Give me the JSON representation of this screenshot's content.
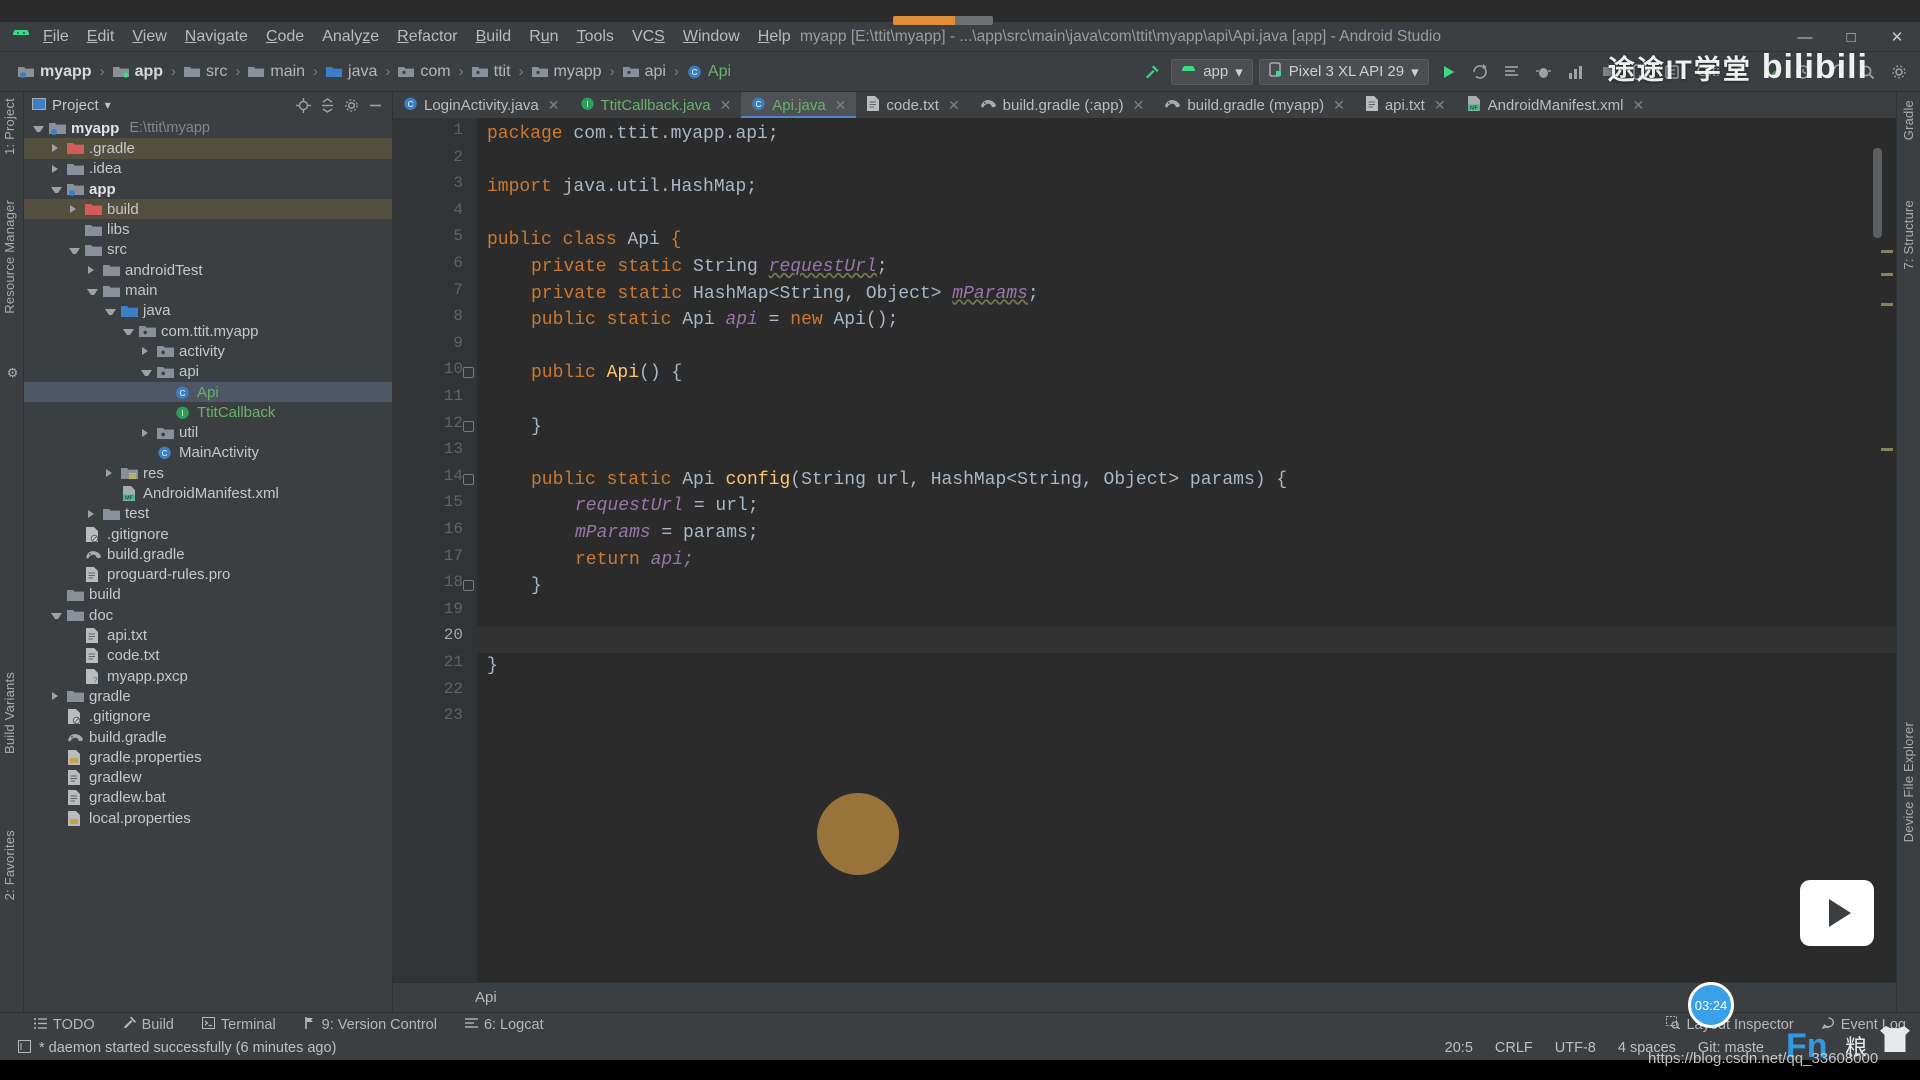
{
  "window": {
    "title": "myapp [E:\\ttit\\myapp] - ...\\app\\src\\main\\java\\com\\ttit\\myapp\\api\\Api.java [app] - Android Studio",
    "minimize": "—",
    "maximize": "□",
    "close": "✕"
  },
  "menu": {
    "items": [
      "File",
      "Edit",
      "View",
      "Navigate",
      "Code",
      "Analyze",
      "Refactor",
      "Build",
      "Run",
      "Tools",
      "VCS",
      "Window",
      "Help"
    ]
  },
  "breadcrumb": {
    "items": [
      {
        "label": "myapp",
        "icon": "module-folder-icon",
        "bold": true
      },
      {
        "label": "app",
        "icon": "module-folder-icon",
        "bold": true
      },
      {
        "label": "src",
        "icon": "folder-icon",
        "bold": false
      },
      {
        "label": "main",
        "icon": "folder-icon",
        "bold": false
      },
      {
        "label": "java",
        "icon": "source-folder-icon",
        "bold": false
      },
      {
        "label": "com",
        "icon": "package-icon",
        "bold": false
      },
      {
        "label": "ttit",
        "icon": "package-icon",
        "bold": false
      },
      {
        "label": "myapp",
        "icon": "package-icon",
        "bold": false
      },
      {
        "label": "api",
        "icon": "package-icon",
        "bold": false
      },
      {
        "label": "Api",
        "icon": "class-icon",
        "bold": false,
        "isClass": true
      }
    ],
    "separator": "›"
  },
  "toolbar": {
    "run_config": "app",
    "device": "Pixel 3 XL API 29",
    "git_label": "Git:",
    "run_icon": "run-icon",
    "rerun_icon": "rerun-icon",
    "apply_changes_icon": "apply-changes-icon",
    "debug_icon": "debug-icon",
    "profile_icon": "profile-icon",
    "avd_icon": "avd-manager-icon",
    "sdk_icon": "sdk-manager-icon",
    "search_icon": "search-icon",
    "commit_icon": "commit-icon",
    "update_icon": "update-project-icon",
    "hammer_icon": "build-hammer-icon"
  },
  "left_strips": [
    {
      "label": "1: Project",
      "name": "tool-window-project"
    },
    {
      "label": "Resource Manager",
      "name": "tool-window-resource-manager"
    },
    {
      "label": "Build Variants",
      "name": "tool-window-build-variants"
    },
    {
      "label": "2: Favorites",
      "name": "tool-window-favorites"
    }
  ],
  "right_strips": [
    {
      "label": "Gradle",
      "name": "tool-window-gradle"
    },
    {
      "label": "7: Structure",
      "name": "tool-window-structure"
    },
    {
      "label": "Device File Explorer",
      "name": "tool-window-device-file-explorer"
    }
  ],
  "project_panel": {
    "title": "Project",
    "dropdown": "▾",
    "tree": [
      {
        "indent": 0,
        "arrow": "down",
        "icon": "module-folder-icon",
        "label": "myapp",
        "bold": true,
        "hint": "E:\\ttit\\myapp"
      },
      {
        "indent": 1,
        "arrow": "right",
        "icon": "excluded-folder-icon",
        "label": ".gradle",
        "highlight": "build"
      },
      {
        "indent": 1,
        "arrow": "right",
        "icon": "folder-icon",
        "label": ".idea"
      },
      {
        "indent": 1,
        "arrow": "down",
        "icon": "module-folder-icon",
        "label": "app",
        "bold": true
      },
      {
        "indent": 2,
        "arrow": "right",
        "icon": "excluded-folder-icon",
        "label": "build",
        "highlight": "build"
      },
      {
        "indent": 2,
        "arrow": "none",
        "icon": "folder-icon",
        "label": "libs"
      },
      {
        "indent": 2,
        "arrow": "down",
        "icon": "folder-icon",
        "label": "src"
      },
      {
        "indent": 3,
        "arrow": "right",
        "icon": "folder-icon",
        "label": "androidTest"
      },
      {
        "indent": 3,
        "arrow": "down",
        "icon": "folder-icon",
        "label": "main"
      },
      {
        "indent": 4,
        "arrow": "down",
        "icon": "source-folder-icon",
        "label": "java"
      },
      {
        "indent": 5,
        "arrow": "down",
        "icon": "package-icon",
        "label": "com.ttit.myapp"
      },
      {
        "indent": 6,
        "arrow": "right",
        "icon": "package-icon",
        "label": "activity"
      },
      {
        "indent": 6,
        "arrow": "down",
        "icon": "package-icon",
        "label": "api"
      },
      {
        "indent": 7,
        "arrow": "none",
        "icon": "java-class-icon",
        "label": "Api",
        "green": true,
        "selected": true
      },
      {
        "indent": 7,
        "arrow": "none",
        "icon": "java-interface-icon",
        "label": "TtitCallback",
        "green": true
      },
      {
        "indent": 6,
        "arrow": "right",
        "icon": "package-icon",
        "label": "util"
      },
      {
        "indent": 6,
        "arrow": "none",
        "icon": "java-class-icon",
        "label": "MainActivity"
      },
      {
        "indent": 4,
        "arrow": "right",
        "icon": "res-folder-icon",
        "label": "res"
      },
      {
        "indent": 4,
        "arrow": "none",
        "icon": "manifest-icon",
        "label": "AndroidManifest.xml"
      },
      {
        "indent": 3,
        "arrow": "right",
        "icon": "folder-icon",
        "label": "test"
      },
      {
        "indent": 2,
        "arrow": "none",
        "icon": "gitignore-icon",
        "label": ".gitignore"
      },
      {
        "indent": 2,
        "arrow": "none",
        "icon": "gradle-icon",
        "label": "build.gradle"
      },
      {
        "indent": 2,
        "arrow": "none",
        "icon": "file-icon",
        "label": "proguard-rules.pro"
      },
      {
        "indent": 1,
        "arrow": "none",
        "icon": "folder-icon",
        "label": "build"
      },
      {
        "indent": 1,
        "arrow": "down",
        "icon": "folder-icon",
        "label": "doc"
      },
      {
        "indent": 2,
        "arrow": "none",
        "icon": "file-icon",
        "label": "api.txt"
      },
      {
        "indent": 2,
        "arrow": "none",
        "icon": "file-icon",
        "label": "code.txt"
      },
      {
        "indent": 2,
        "arrow": "none",
        "icon": "unknown-file-icon",
        "label": "myapp.pxcp"
      },
      {
        "indent": 1,
        "arrow": "right",
        "icon": "folder-icon",
        "label": "gradle"
      },
      {
        "indent": 1,
        "arrow": "none",
        "icon": "gitignore-icon",
        "label": ".gitignore"
      },
      {
        "indent": 1,
        "arrow": "none",
        "icon": "gradle-icon",
        "label": "build.gradle"
      },
      {
        "indent": 1,
        "arrow": "none",
        "icon": "properties-icon",
        "label": "gradle.properties"
      },
      {
        "indent": 1,
        "arrow": "none",
        "icon": "file-icon",
        "label": "gradlew"
      },
      {
        "indent": 1,
        "arrow": "none",
        "icon": "file-icon",
        "label": "gradlew.bat"
      },
      {
        "indent": 1,
        "arrow": "none",
        "icon": "properties-icon",
        "label": "local.properties"
      }
    ]
  },
  "editor": {
    "tabs": [
      {
        "label": "LoginActivity.java",
        "icon": "java-class-icon",
        "active": false,
        "close": "✕"
      },
      {
        "label": "TtitCallback.java",
        "icon": "java-interface-icon",
        "active": false,
        "close": "✕"
      },
      {
        "label": "Api.java",
        "icon": "java-class-icon",
        "active": true,
        "close": "✕"
      },
      {
        "label": "code.txt",
        "icon": "file-icon",
        "active": false,
        "close": "✕"
      },
      {
        "label": "build.gradle (:app)",
        "icon": "gradle-icon",
        "active": false,
        "close": "✕"
      },
      {
        "label": "build.gradle (myapp)",
        "icon": "gradle-icon",
        "active": false,
        "close": "✕"
      },
      {
        "label": "api.txt",
        "icon": "file-icon",
        "active": false,
        "close": "✕"
      },
      {
        "label": "AndroidManifest.xml",
        "icon": "manifest-icon",
        "active": false,
        "close": "✕"
      }
    ],
    "line_numbers": [
      "1",
      "2",
      "3",
      "4",
      "5",
      "6",
      "7",
      "8",
      "9",
      "10",
      "11",
      "12",
      "13",
      "14",
      "15",
      "16",
      "17",
      "18",
      "19",
      "20",
      "21",
      "22",
      "23"
    ],
    "current_line": 20,
    "breadcrumb_bottom": "Api",
    "code_lines": [
      {
        "n": 1,
        "indent": 0,
        "tokens": [
          {
            "t": "package ",
            "c": "k"
          },
          {
            "t": "com.ttit.myapp.api;",
            "c": "p"
          }
        ]
      },
      {
        "n": 2,
        "indent": 0,
        "tokens": []
      },
      {
        "n": 3,
        "indent": 0,
        "tokens": [
          {
            "t": "import ",
            "c": "k"
          },
          {
            "t": "java.util.HashMap;",
            "c": "p"
          }
        ]
      },
      {
        "n": 4,
        "indent": 0,
        "tokens": []
      },
      {
        "n": 5,
        "indent": 0,
        "tokens": [
          {
            "t": "public class ",
            "c": "k"
          },
          {
            "t": "Api ",
            "c": "p"
          },
          {
            "t": "{",
            "c": "k"
          }
        ]
      },
      {
        "n": 6,
        "indent": 1,
        "tokens": [
          {
            "t": "private static ",
            "c": "k"
          },
          {
            "t": "String ",
            "c": "p"
          },
          {
            "t": "requestUrl",
            "c": "f"
          },
          {
            "t": ";",
            "c": "p"
          }
        ]
      },
      {
        "n": 7,
        "indent": 1,
        "tokens": [
          {
            "t": "private static ",
            "c": "k"
          },
          {
            "t": "HashMap<String, Object> ",
            "c": "p"
          },
          {
            "t": "mParams",
            "c": "f"
          },
          {
            "t": ";",
            "c": "p"
          }
        ]
      },
      {
        "n": 8,
        "indent": 1,
        "tokens": [
          {
            "t": "public static ",
            "c": "k"
          },
          {
            "t": "Api ",
            "c": "p"
          },
          {
            "t": "api ",
            "c": "f2"
          },
          {
            "t": "= ",
            "c": "p"
          },
          {
            "t": "new ",
            "c": "k"
          },
          {
            "t": "Api();",
            "c": "p"
          }
        ]
      },
      {
        "n": 9,
        "indent": 0,
        "tokens": []
      },
      {
        "n": 10,
        "indent": 1,
        "tokens": [
          {
            "t": "public ",
            "c": "k"
          },
          {
            "t": "Api",
            "c": "m"
          },
          {
            "t": "() {",
            "c": "p"
          }
        ]
      },
      {
        "n": 11,
        "indent": 0,
        "tokens": []
      },
      {
        "n": 12,
        "indent": 1,
        "tokens": [
          {
            "t": "}",
            "c": "p"
          }
        ]
      },
      {
        "n": 13,
        "indent": 0,
        "tokens": []
      },
      {
        "n": 14,
        "indent": 1,
        "tokens": [
          {
            "t": "public static ",
            "c": "k"
          },
          {
            "t": "Api ",
            "c": "p"
          },
          {
            "t": "config",
            "c": "m"
          },
          {
            "t": "(String url, HashMap<String, Object> params) {",
            "c": "p"
          }
        ]
      },
      {
        "n": 15,
        "indent": 2,
        "tokens": [
          {
            "t": "requestUrl ",
            "c": "f2"
          },
          {
            "t": "= url;",
            "c": "p"
          }
        ]
      },
      {
        "n": 16,
        "indent": 2,
        "tokens": [
          {
            "t": "mParams ",
            "c": "f2"
          },
          {
            "t": "= params;",
            "c": "p"
          }
        ]
      },
      {
        "n": 17,
        "indent": 2,
        "tokens": [
          {
            "t": "return ",
            "c": "k"
          },
          {
            "t": "api;",
            "c": "f2"
          }
        ]
      },
      {
        "n": 18,
        "indent": 1,
        "tokens": [
          {
            "t": "}",
            "c": "p"
          }
        ]
      },
      {
        "n": 19,
        "indent": 0,
        "tokens": []
      },
      {
        "n": 20,
        "indent": 0,
        "tokens": []
      },
      {
        "n": 21,
        "indent": 0,
        "tokens": [
          {
            "t": "}",
            "c": "p"
          }
        ]
      },
      {
        "n": 22,
        "indent": 0,
        "tokens": []
      },
      {
        "n": 23,
        "indent": 0,
        "tokens": []
      }
    ],
    "fold_lines": [
      10,
      12,
      14,
      18
    ]
  },
  "tool_windows": {
    "items": [
      {
        "label": "TODO",
        "icon": "todo-icon",
        "mnemonic": ""
      },
      {
        "label": "Build",
        "icon": "build-hammer-icon",
        "mnemonic": ""
      },
      {
        "label": "Terminal",
        "icon": "terminal-icon",
        "mnemonic": ""
      },
      {
        "label": "9: Version Control",
        "icon": "vcs-icon",
        "mnemonic": "9"
      },
      {
        "label": "6: Logcat",
        "icon": "logcat-icon",
        "mnemonic": "6"
      }
    ],
    "right_items": [
      {
        "label": "Layout Inspector",
        "icon": "layout-inspector-icon"
      },
      {
        "label": "Event Log",
        "icon": "event-log-icon"
      }
    ]
  },
  "statusbar": {
    "message": "* daemon started successfully (6 minutes ago)",
    "message_icon": "console-icon",
    "caret": "20:5",
    "line_separator": "CRLF",
    "encoding": "UTF-8",
    "indent": "4 spaces",
    "branch": "Git: maste"
  },
  "overlays": {
    "watermark_cn": "途途IT学堂",
    "watermark_bili": "bilibili",
    "rec_time": "03:24",
    "blog_url": "https://blog.csdn.net/qq_33608000",
    "fn_key": "Fn"
  },
  "colors": {
    "bg_panel": "#3c3f41",
    "bg_editor": "#2b2b2b",
    "accent_green": "#68b16a",
    "accent_blue": "#4a88c7",
    "keyword_orange": "#cc7832",
    "field_purple": "#9876aa",
    "method_yellow": "#ffc66d",
    "selection": "#4d5765"
  }
}
